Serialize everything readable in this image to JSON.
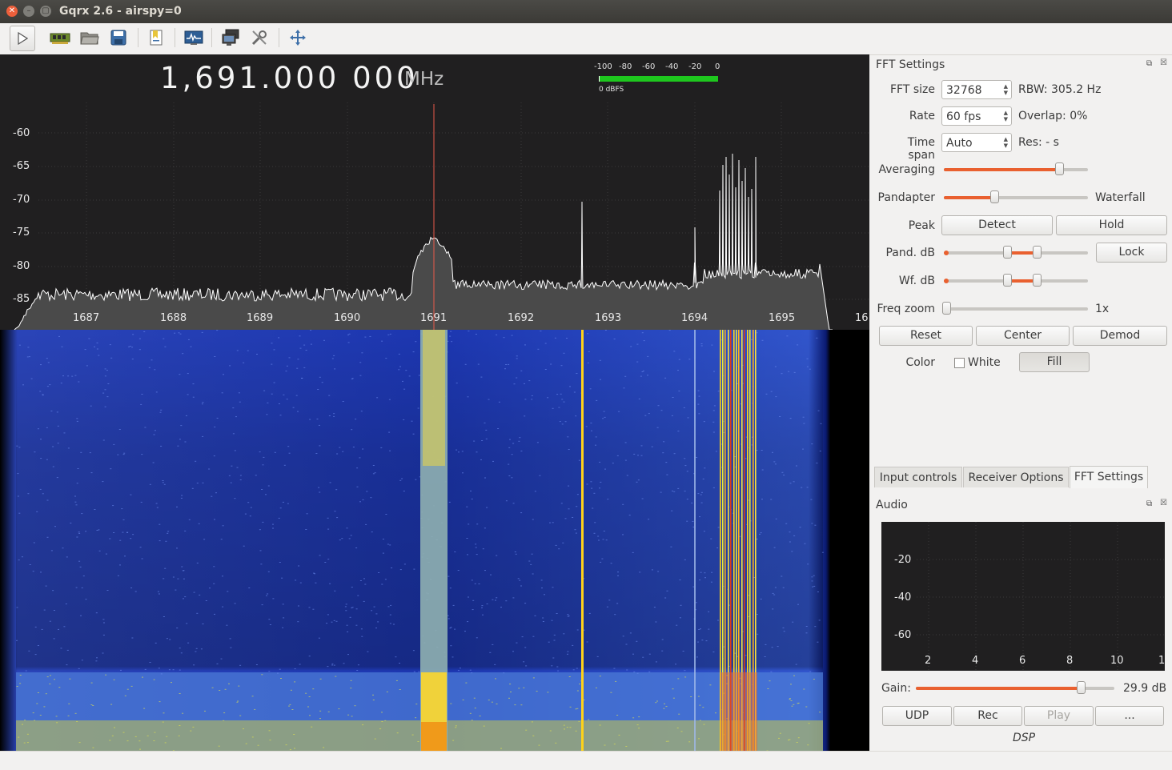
{
  "window": {
    "title": "Gqrx 2.6 - airspy=0"
  },
  "toolbar": {
    "icons": [
      "play-icon",
      "hardware-icon",
      "open-icon",
      "save-icon",
      "bookmark-icon",
      "spectrum-icon",
      "network-icon",
      "tools-icon",
      "fullscreen-icon"
    ]
  },
  "display": {
    "frequency": "1,691.000 000",
    "unit": "MHz",
    "meter_scale": [
      "-100",
      "-80",
      "-60",
      "-40",
      "-20",
      "0"
    ],
    "meter_label": "0 dBFS"
  },
  "spectrum": {
    "y_ticks": [
      "-60",
      "-65",
      "-70",
      "-75",
      "-80",
      "-85"
    ],
    "x_ticks": [
      "1687",
      "1688",
      "1689",
      "1690",
      "1691",
      "1692",
      "1693",
      "1694",
      "1695",
      "16"
    ]
  },
  "fft": {
    "title": "FFT Settings",
    "fft_size_label": "FFT size",
    "fft_size": "32768",
    "rbw": "RBW: 305.2 Hz",
    "rate_label": "Rate",
    "rate": "60 fps",
    "overlap": "Overlap: 0%",
    "timespan_label": "Time span",
    "timespan": "Auto",
    "res": "Res: - s",
    "averaging_label": "Averaging",
    "averaging_level": 0.8,
    "pandapter_label": "Pandapter",
    "waterfall_label": "Waterfall",
    "pandapter_split": 0.35,
    "peak_label": "Peak",
    "detect": "Detect",
    "hold": "Hold",
    "pand_db_label": "Pand. dB",
    "lock": "Lock",
    "wf_db_label": "Wf. dB",
    "freq_zoom_label": "Freq zoom",
    "freq_zoom": "1x",
    "reset": "Reset",
    "center": "Center",
    "demod": "Demod",
    "color_label": "Color",
    "white": "White",
    "fill": "Fill"
  },
  "tabs": [
    "Input controls",
    "Receiver Options",
    "FFT Settings"
  ],
  "audio": {
    "title": "Audio",
    "y_ticks": [
      "-20",
      "-40",
      "-60"
    ],
    "x_ticks": [
      "2",
      "4",
      "6",
      "8",
      "10",
      "1"
    ],
    "gain_label": "Gain:",
    "gain_value": "29.9 dB",
    "gain_level": 0.83,
    "udp": "UDP",
    "rec": "Rec",
    "play": "Play",
    "more": "...",
    "dsp": "DSP"
  },
  "colors": {
    "accent": "#e9602f",
    "plot_bg": "#201f20",
    "meter": "#1ec71e",
    "marker": "#e85a4a"
  }
}
